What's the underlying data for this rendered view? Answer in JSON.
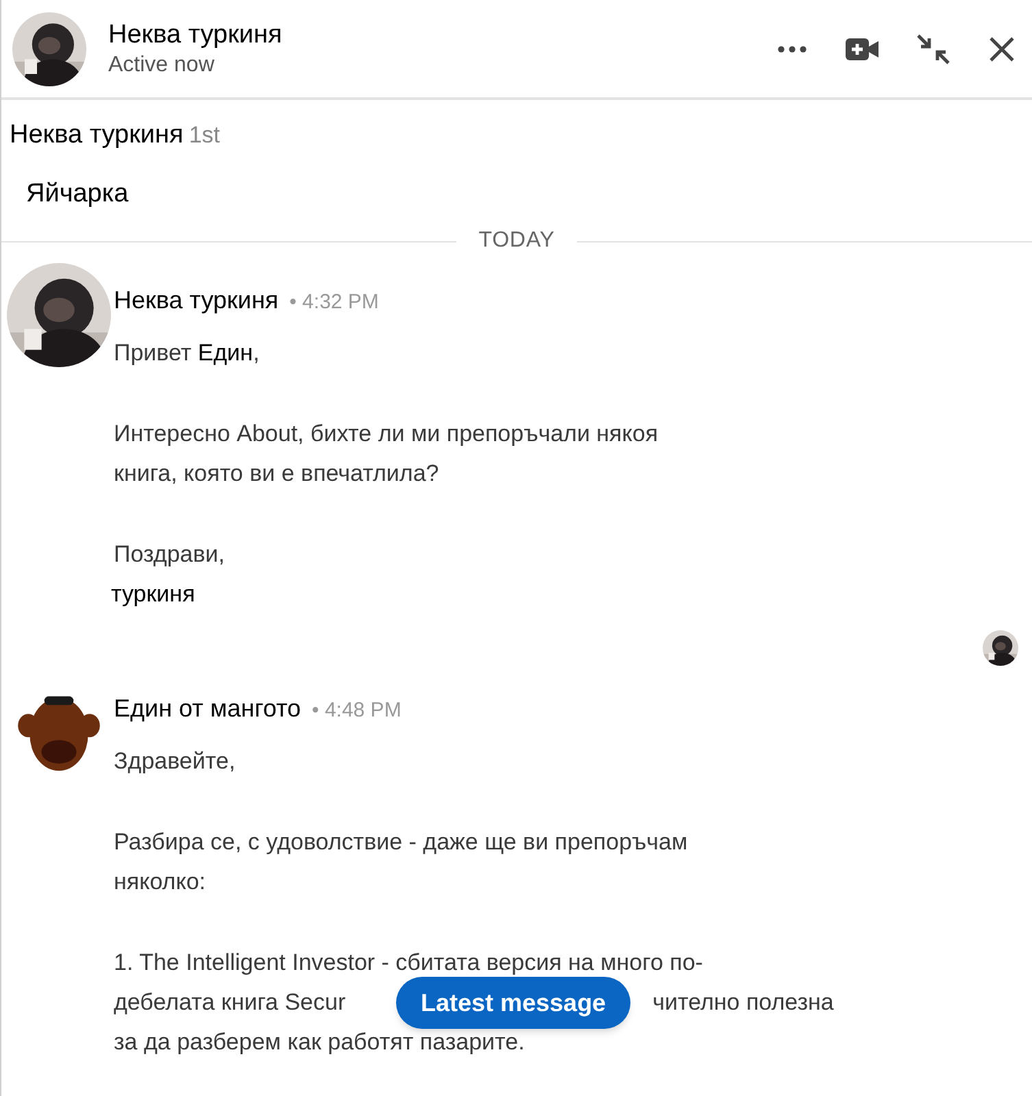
{
  "header": {
    "name": "Неква туркиня",
    "status": "Active now"
  },
  "profile": {
    "name": "Неква туркиня",
    "degree": "1st",
    "headline": "Яйчарка"
  },
  "date_divider": "TODAY",
  "messages": [
    {
      "sender": "Неква туркиня",
      "time": "• 4:32 PM",
      "paragraphs": [
        [
          {
            "text": "Привет **Един**,"
          }
        ],
        [
          {
            "text": "Интересно About, бихте ли ми препоръчали някоя"
          },
          {
            "text": "книга, която ви е впечатлила?"
          }
        ],
        [
          {
            "text": "Поздрави,"
          },
          {
            "text": "туркиня",
            "emphasis": true
          }
        ]
      ],
      "read_receipt": true
    },
    {
      "sender": "Един от мангото",
      "time": "• 4:48 PM",
      "paragraphs": [
        [
          {
            "text": "Здравейте,"
          }
        ],
        [
          {
            "text": "Разбира се, с удоволствие - даже ще ви препоръчам"
          },
          {
            "text": "няколко:"
          }
        ],
        [
          {
            "text": "1. The Intelligent Investor - сбитата версия на много по-"
          },
          {
            "segments": [
              "дебелата книга Secur",
              "чително полезна"
            ]
          },
          {
            "text": "за да разберем как работят пазарите."
          }
        ]
      ],
      "read_receipt": false
    }
  ],
  "latest_button": "Latest message"
}
